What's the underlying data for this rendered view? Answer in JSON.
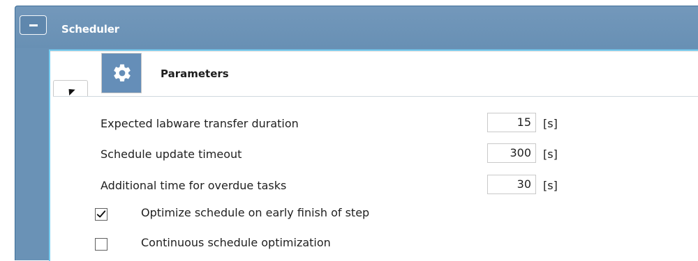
{
  "scheduler": {
    "title": "Scheduler"
  },
  "parameters": {
    "title": "Parameters"
  },
  "fields": [
    {
      "label": "Expected labware transfer duration",
      "value": "15",
      "unit": "[s]"
    },
    {
      "label": "Schedule update timeout",
      "value": "300",
      "unit": "[s]"
    },
    {
      "label": "Additional time for overdue tasks",
      "value": "30",
      "unit": "[s]"
    }
  ],
  "options": [
    {
      "label": "Optimize schedule on early finish of step",
      "checked": true
    },
    {
      "label": "Continuous schedule optimization",
      "checked": false
    }
  ],
  "icons": {
    "collapse": "minus-icon",
    "section_toggle": "collapse-triangle-icon",
    "parameters": "gear-icon",
    "checked": "check-icon"
  },
  "colors": {
    "header": "#6a92b6",
    "accent": "#73ccf0",
    "icon_background": "#658eb8"
  }
}
